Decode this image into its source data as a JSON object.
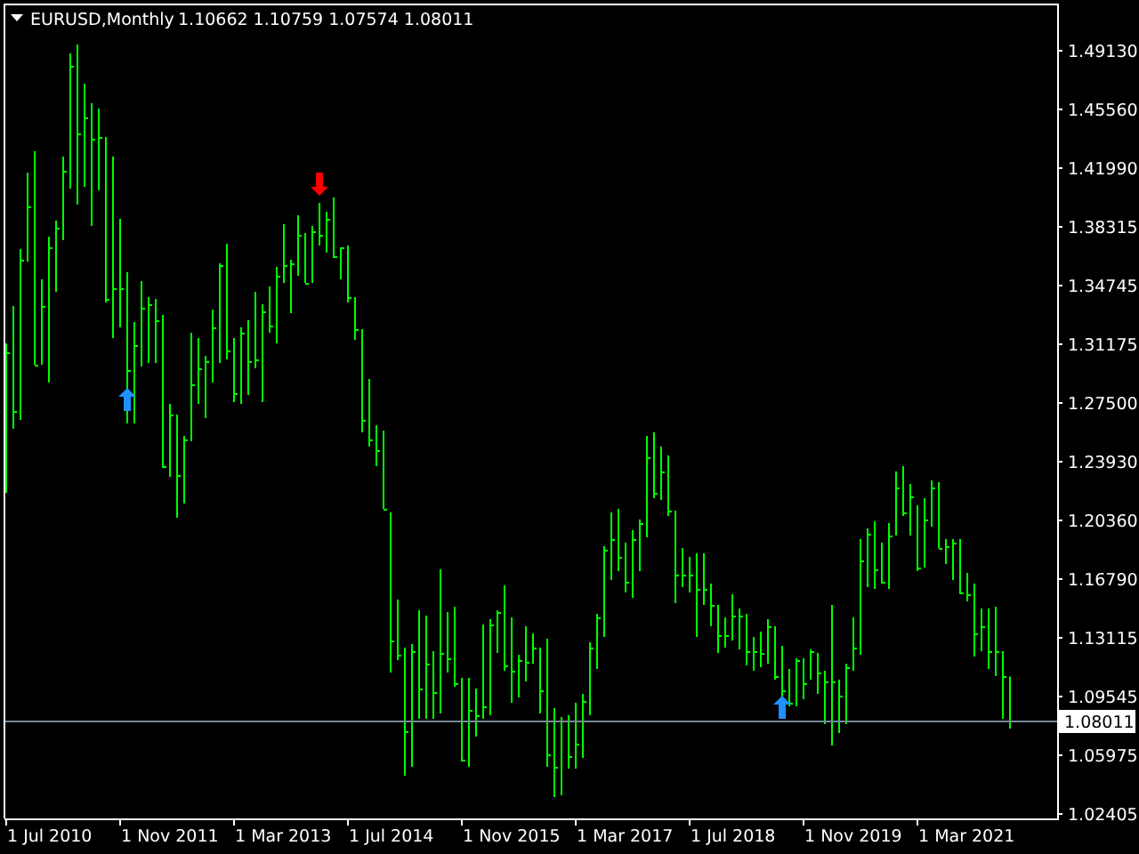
{
  "chart": {
    "header": {
      "symbol": "EURUSD,Monthly",
      "ohlc": [
        "1.10662",
        "1.10759",
        "1.07574",
        "1.08011"
      ]
    },
    "price_axis": [
      "1.49130",
      "1.45560",
      "1.41990",
      "1.38315",
      "1.34745",
      "1.31175",
      "1.27500",
      "1.23930",
      "1.20360",
      "1.16790",
      "1.13115",
      "1.09545",
      "1.05975",
      "1.02405"
    ],
    "date_axis": [
      "1 Jul 2010",
      "1 Nov 2011",
      "1 Mar 2013",
      "1 Jul 2014",
      "1 Nov 2015",
      "1 Mar 2017",
      "1 Jul 2018",
      "1 Nov 2019",
      "1 Mar 2021"
    ],
    "current_price": "1.08011"
  }
}
